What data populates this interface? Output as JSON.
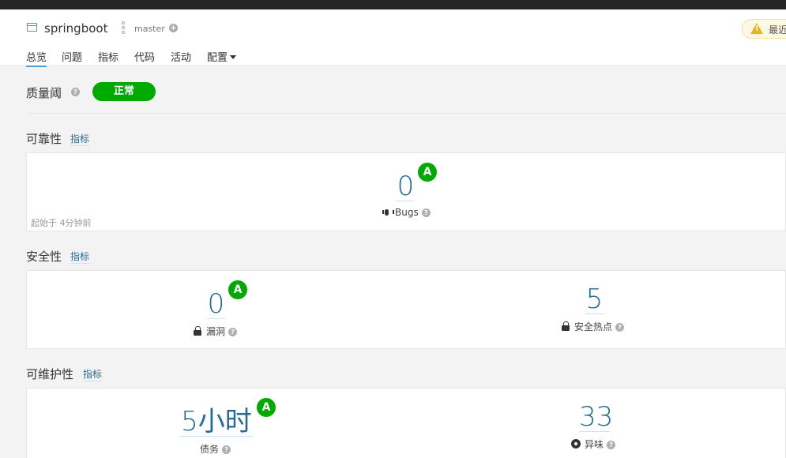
{
  "header": {
    "project_name": "springboot",
    "branch": "master",
    "warning_text": "最近",
    "nav": [
      {
        "label": "总览"
      },
      {
        "label": "问题"
      },
      {
        "label": "指标"
      },
      {
        "label": "代码"
      },
      {
        "label": "活动"
      },
      {
        "label": "配置"
      }
    ]
  },
  "quality_gate": {
    "label": "质量阈",
    "status": "正常",
    "status_color": "#00aa00"
  },
  "reliability": {
    "title": "可靠性",
    "link": "指标",
    "bugs_value": "0",
    "bugs_rating": "A",
    "bugs_label": "Bugs",
    "since": "起始于 4分钟前"
  },
  "security": {
    "title": "安全性",
    "link": "指标",
    "vuln_value": "0",
    "vuln_rating": "A",
    "vuln_label": "漏洞",
    "hotspot_value": "5",
    "hotspot_label": "安全热点"
  },
  "maintainability": {
    "title": "可维护性",
    "link": "指标",
    "debt_value": "5小时",
    "debt_rating": "A",
    "debt_label": "债务",
    "smells_value": "33",
    "smells_label": "异味"
  },
  "colors": {
    "accent": "#236a97",
    "rating_a": "#00aa00",
    "nav_active": "#4b9fd5"
  }
}
